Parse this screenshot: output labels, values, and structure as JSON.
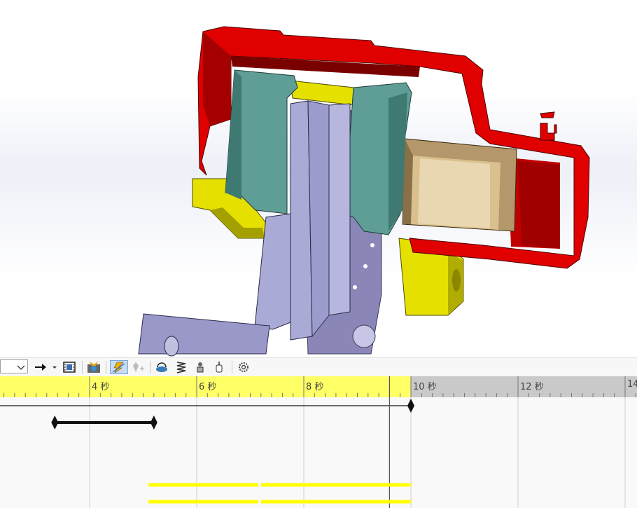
{
  "timeline": {
    "ticks": [
      {
        "value": 2,
        "label": ""
      },
      {
        "value": 4,
        "label": "4 秒"
      },
      {
        "value": 6,
        "label": "6 秒"
      },
      {
        "value": 8,
        "label": "8 秒"
      },
      {
        "value": 10,
        "label": "10 秒"
      },
      {
        "value": 12,
        "label": "12 秒"
      },
      {
        "value": 14,
        "label": "14"
      }
    ],
    "duration_seconds": 10,
    "time_bar_seconds": 9.6,
    "keyframes": [
      {
        "row": "main",
        "start": 2.0,
        "end": 10.0
      },
      {
        "row": "key",
        "start": 3.35,
        "end": 5.2
      }
    ],
    "yellow_bars": [
      {
        "row": 1,
        "start": 5.1,
        "end": 7.15
      },
      {
        "row": 1,
        "start": 7.2,
        "end": 10.0
      },
      {
        "row": 2,
        "start": 5.1,
        "end": 7.15
      },
      {
        "row": 2,
        "start": 7.2,
        "end": 10.0
      }
    ]
  },
  "toolbar": {
    "icons": [
      "dropdown-selector",
      "play-arrow-icon",
      "film-icon",
      "camera-icon",
      "auto-key-icon",
      "add-key-icon",
      "motor-icon",
      "spring-icon",
      "contact-icon",
      "gravity-icon",
      "settings-icon"
    ]
  },
  "colors": {
    "ruler_active": "#ffff66",
    "ruler_inactive": "#c9c9c9",
    "caliper_red": "#e00000",
    "pad_teal": "#5f9e96",
    "bracket_yellow": "#e6e000",
    "disc_lavender": "#aaaad6",
    "piston_tan": "#c9a86a"
  }
}
